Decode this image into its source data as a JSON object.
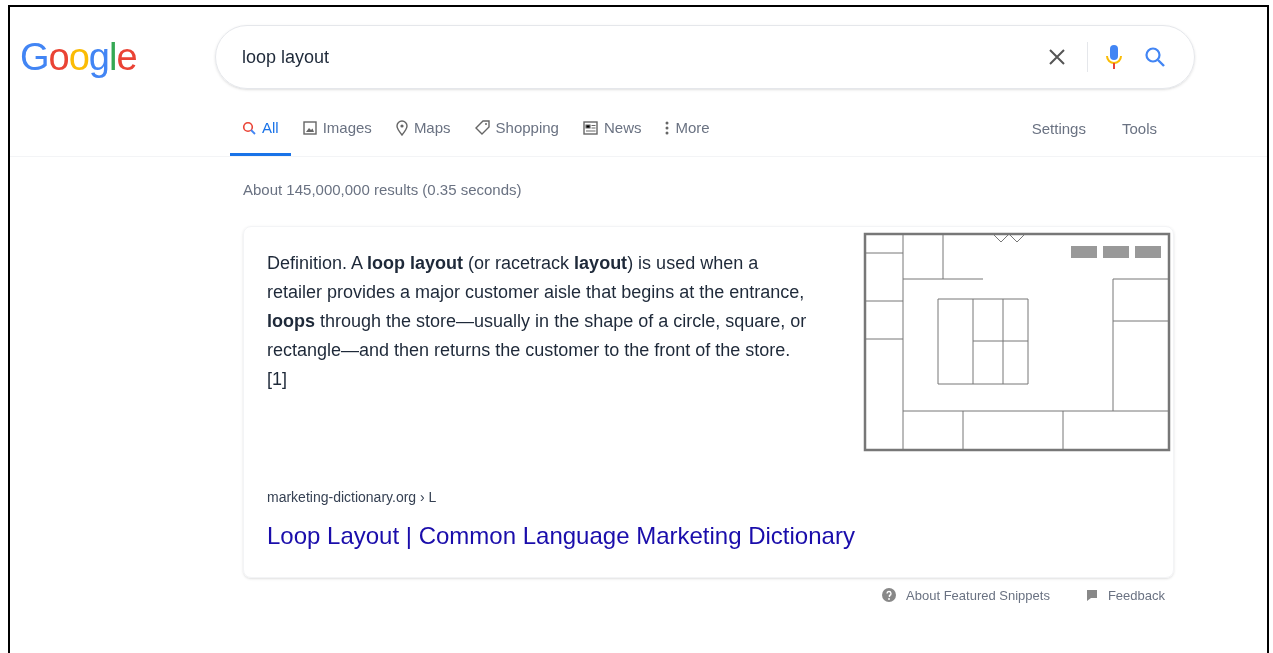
{
  "logo": "Google",
  "search": {
    "value": "loop layout"
  },
  "tabs": [
    {
      "label": "All",
      "selected": true
    },
    {
      "label": "Images",
      "selected": false
    },
    {
      "label": "Maps",
      "selected": false
    },
    {
      "label": "Shopping",
      "selected": false
    },
    {
      "label": "News",
      "selected": false
    },
    {
      "label": "More",
      "selected": false
    }
  ],
  "tools": [
    "Settings",
    "Tools"
  ],
  "result_stats": "About 145,000,000 results (0.35 seconds)",
  "snippet": {
    "text": "Definition. A **loop layout** (or racetrack **layout**) is used when a retailer provides a major customer aisle that begins at the entrance, **loops** through the store—usually in the shape of a circle, square, or rectangle—and then returns the customer to the front of the store. [1]",
    "breadcrumb": "marketing-dictionary.org › L",
    "title": "Loop Layout | Common Language Marketing Dictionary"
  },
  "footer": [
    "About Featured Snippets",
    "Feedback"
  ]
}
